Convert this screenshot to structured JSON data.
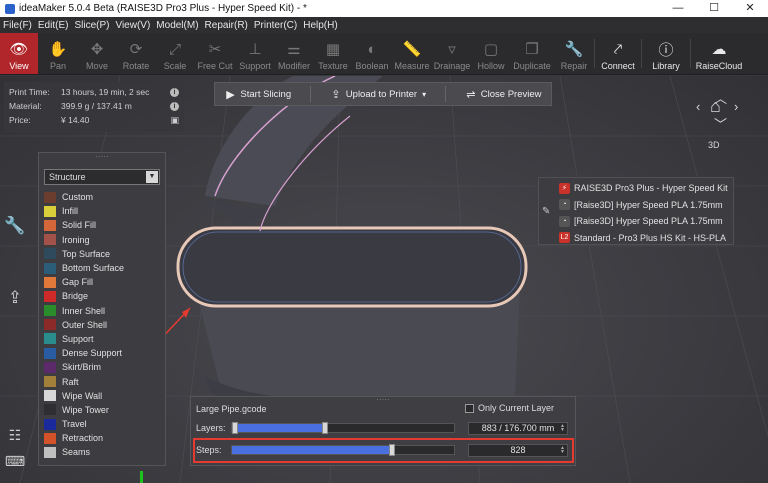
{
  "window": {
    "title": "ideaMaker 5.0.4 Beta (RAISE3D Pro3 Plus - Hyper Speed Kit) - *",
    "minimize": "—",
    "maximize": "☐",
    "close": "✕"
  },
  "menu": [
    "File(F)",
    "Edit(E)",
    "Slice(P)",
    "View(V)",
    "Model(M)",
    "Repair(R)",
    "Printer(C)",
    "Help(H)"
  ],
  "toolbar": {
    "tools": [
      {
        "label": "View",
        "icon": "eye-icon",
        "glyph": "👁"
      },
      {
        "label": "Pan",
        "icon": "hand-icon",
        "glyph": "✋"
      },
      {
        "label": "Move",
        "icon": "move-icon",
        "glyph": "✥"
      },
      {
        "label": "Rotate",
        "icon": "rotate-icon",
        "glyph": "⟳"
      },
      {
        "label": "Scale",
        "icon": "scale-icon",
        "glyph": "⤢"
      },
      {
        "label": "Free Cut",
        "icon": "cut-icon",
        "glyph": "✂"
      },
      {
        "label": "Support",
        "icon": "support-icon",
        "glyph": "⊥"
      },
      {
        "label": "Modifier",
        "icon": "modifier-icon",
        "glyph": "⚌"
      },
      {
        "label": "Texture",
        "icon": "texture-icon",
        "glyph": "▦"
      },
      {
        "label": "Boolean",
        "icon": "boolean-icon",
        "glyph": "◐"
      },
      {
        "label": "Measure",
        "icon": "measure-icon",
        "glyph": "📏"
      },
      {
        "label": "Drainage",
        "icon": "drainage-icon",
        "glyph": "▿"
      },
      {
        "label": "Hollow",
        "icon": "hollow-icon",
        "glyph": "▢"
      },
      {
        "label": "Duplicate",
        "icon": "duplicate-icon",
        "glyph": "❐"
      },
      {
        "label": "Repair",
        "icon": "wrench-icon",
        "glyph": "🔧"
      }
    ],
    "right_tools": [
      {
        "label": "Connect",
        "icon": "connect-icon",
        "glyph": "⤤"
      },
      {
        "label": "Library",
        "icon": "library-icon",
        "glyph": "ⓘ"
      },
      {
        "label": "RaiseCloud",
        "icon": "cloud-icon",
        "glyph": "☁"
      }
    ]
  },
  "info": {
    "print_time_label": "Print Time:",
    "print_time": "13 hours, 19 min, 2 sec",
    "material_label": "Material:",
    "material": "399.9 g / 137.41 m",
    "price_label": "Price:",
    "price": "¥ 14.40"
  },
  "actions": {
    "start_slicing": "Start Slicing",
    "upload": "Upload to Printer",
    "close_preview": "Close Preview"
  },
  "legend": {
    "selected": "Structure",
    "items": [
      {
        "label": "Custom",
        "color": "#6b3d2e"
      },
      {
        "label": "Infill",
        "color": "#d9cf3a"
      },
      {
        "label": "Solid Fill",
        "color": "#d4673a"
      },
      {
        "label": "Ironing",
        "color": "#a3524a"
      },
      {
        "label": "Top Surface",
        "color": "#2f4a5c"
      },
      {
        "label": "Bottom Surface",
        "color": "#2b5c78"
      },
      {
        "label": "Gap Fill",
        "color": "#e0793a"
      },
      {
        "label": "Bridge",
        "color": "#cf2a2a"
      },
      {
        "label": "Inner Shell",
        "color": "#2a8c2a"
      },
      {
        "label": "Outer Shell",
        "color": "#8c2a2a"
      },
      {
        "label": "Support",
        "color": "#2a8c8c"
      },
      {
        "label": "Dense Support",
        "color": "#2a5ca3"
      },
      {
        "label": "Skirt/Brim",
        "color": "#5c2a6b"
      },
      {
        "label": "Raft",
        "color": "#a3803a"
      },
      {
        "label": "Wipe Wall",
        "color": "#d8d8d8"
      },
      {
        "label": "Wipe Tower",
        "color": "#2f2f33"
      },
      {
        "label": "Travel",
        "color": "#1a2a9c"
      },
      {
        "label": "Retraction",
        "color": "#d4522a"
      },
      {
        "label": "Seams",
        "color": "#c0c0c0"
      }
    ]
  },
  "printer": {
    "items": [
      {
        "label": "RAISE3D Pro3 Plus - Hyper Speed Kit",
        "icon": "printer-icon",
        "glyph": "⚡",
        "color": "#c8322a"
      },
      {
        "label": "[Raise3D] Hyper Speed PLA 1.75mm",
        "icon": "filament-icon",
        "glyph": "◔",
        "color": "#555"
      },
      {
        "label": "[Raise3D] Hyper Speed PLA 1.75mm",
        "icon": "filament-icon",
        "glyph": "◔",
        "color": "#555"
      },
      {
        "label": "Standard - Pro3 Plus HS Kit - HS-PLA",
        "icon": "profile-icon",
        "glyph": "L2",
        "color": "#c8322a"
      }
    ]
  },
  "slider": {
    "file_name": "Large Pipe.gcode",
    "only_current_layer": "Only Current Layer",
    "layers_label": "Layers:",
    "layers_value": "883 / 176.700 mm",
    "layers_fraction": 0.42,
    "steps_label": "Steps:",
    "steps_value": "828",
    "steps_fraction": 0.72
  }
}
